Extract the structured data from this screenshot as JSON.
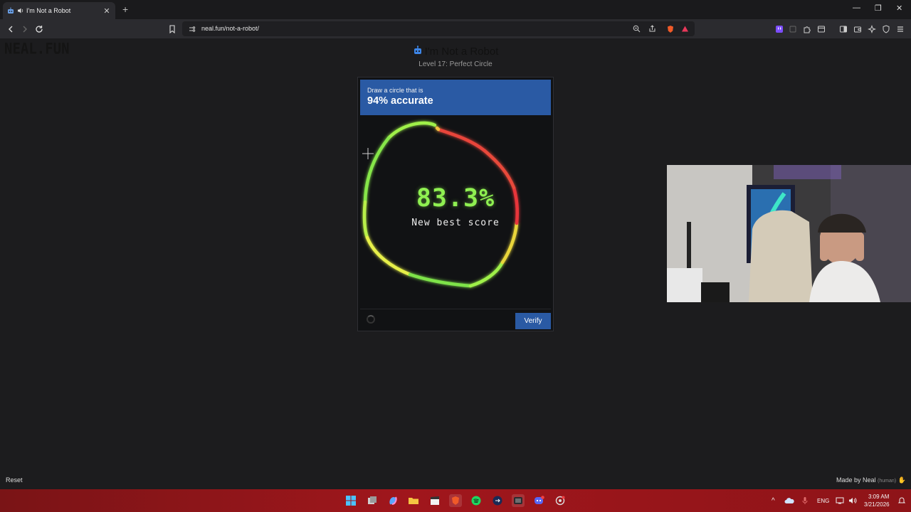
{
  "browser": {
    "tab_title": "I'm Not a Robot",
    "new_tab_label": "+",
    "url": "neal.fun/not-a-robot/"
  },
  "page": {
    "logo": "NEAL.FUN",
    "heading": "I'm Not a Robot",
    "level": "Level 17: Perfect Circle",
    "captcha": {
      "instruction": "Draw a circle that is",
      "target": "94% accurate",
      "score": "83.3%",
      "score_note": "New best score",
      "verify_label": "Verify"
    },
    "reset_label": "Reset",
    "made_by": "Made by Neal",
    "made_by_note": "(human)"
  },
  "taskbar": {
    "language": "ENG",
    "time": "3:09 AM",
    "date": "3/21/2026"
  },
  "colors": {
    "accent_blue": "#2a5aa4",
    "score_green": "#8ff051",
    "taskbar_red": "#a0161c"
  }
}
